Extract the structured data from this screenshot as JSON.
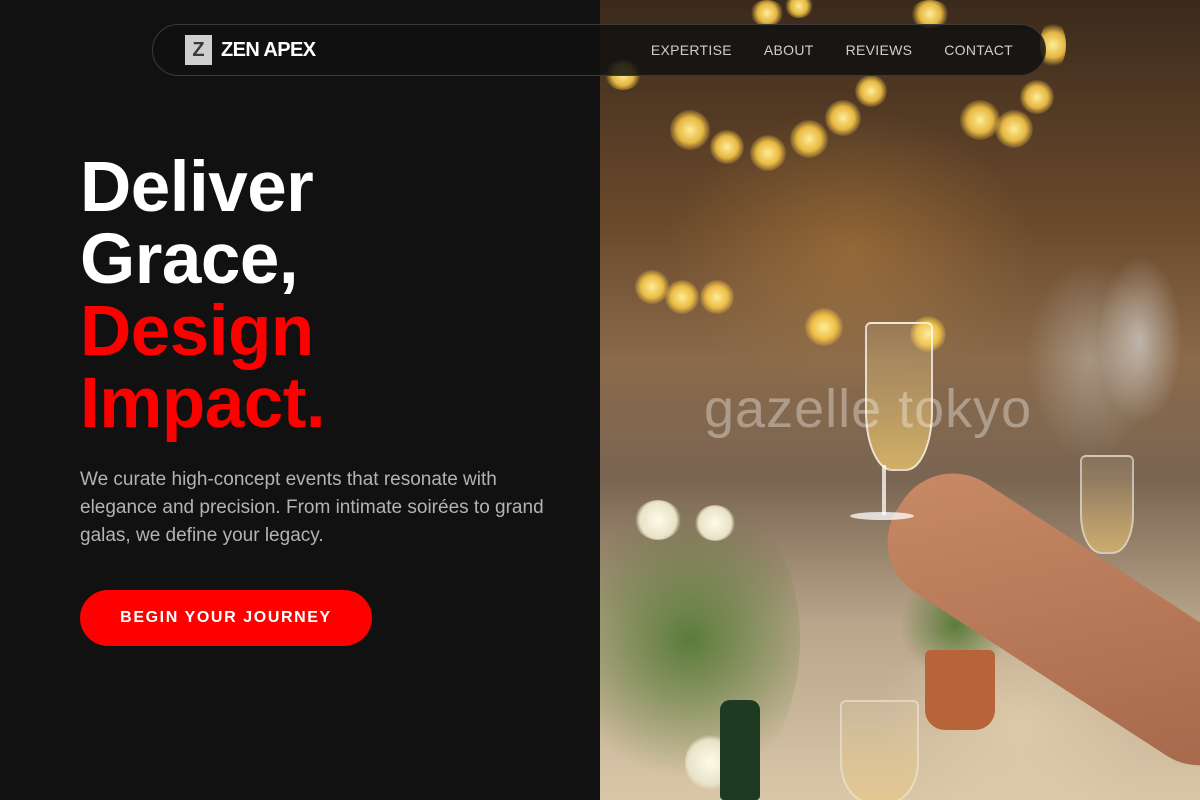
{
  "nav": {
    "logo_mark": "Z",
    "brand": "ZEN APEX",
    "links": [
      {
        "label": "EXPERTISE"
      },
      {
        "label": "ABOUT"
      },
      {
        "label": "REVIEWS"
      },
      {
        "label": "CONTACT"
      }
    ]
  },
  "hero": {
    "headline_line1": "Deliver",
    "headline_line2": "Grace,",
    "headline_line3": "Design",
    "headline_line4": "Impact.",
    "description": "We curate high-concept events that resonate with elegance and precision. From intimate soirées to grand galas, we define your legacy.",
    "cta_label": "BEGIN YOUR JOURNEY"
  },
  "image": {
    "watermark": "gazelle tokyo"
  },
  "colors": {
    "background": "#111111",
    "accent": "#ff0000",
    "text_primary": "#ffffff",
    "text_muted": "#b3b3b3"
  }
}
